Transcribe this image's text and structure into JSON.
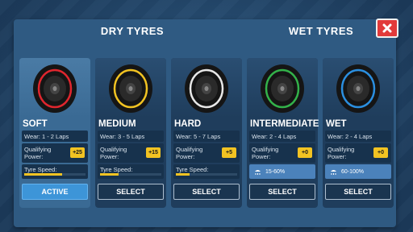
{
  "header": {
    "dry_title": "DRY TYRES",
    "wet_title": "WET TYRES",
    "close_icon": "close-icon"
  },
  "colors": {
    "soft": "#e0262e",
    "medium": "#f2c322",
    "hard": "#e8e8e8",
    "intermediate": "#33b24a",
    "wet": "#2b8fe0",
    "badge": "#f2c322",
    "active_button": "#3d95d8"
  },
  "labels": {
    "qualifying": "Qualifying Power:",
    "tyre_speed": "Tyre Speed:"
  },
  "cards": [
    {
      "name": "SOFT",
      "wear": "Wear: 1 - 2 Laps",
      "qualifying_bonus": "+25",
      "speed": 0.62,
      "button": "ACTIVE",
      "active": true
    },
    {
      "name": "MEDIUM",
      "wear": "Wear: 3 - 5 Laps",
      "qualifying_bonus": "+15",
      "speed": 0.3,
      "button": "SELECT",
      "active": false
    },
    {
      "name": "HARD",
      "wear": "Wear: 5 - 7 Laps",
      "qualifying_bonus": "+5",
      "speed": 0.22,
      "button": "SELECT",
      "active": false
    },
    {
      "name": "INTERMEDIATE",
      "wear": "Wear: 2 - 4 Laps",
      "qualifying_bonus": "+0",
      "rain": "15-60%",
      "button": "SELECT",
      "active": false
    },
    {
      "name": "WET",
      "wear": "Wear: 2 - 4 Laps",
      "qualifying_bonus": "+0",
      "rain": "60-100%",
      "button": "SELECT",
      "active": false
    }
  ]
}
